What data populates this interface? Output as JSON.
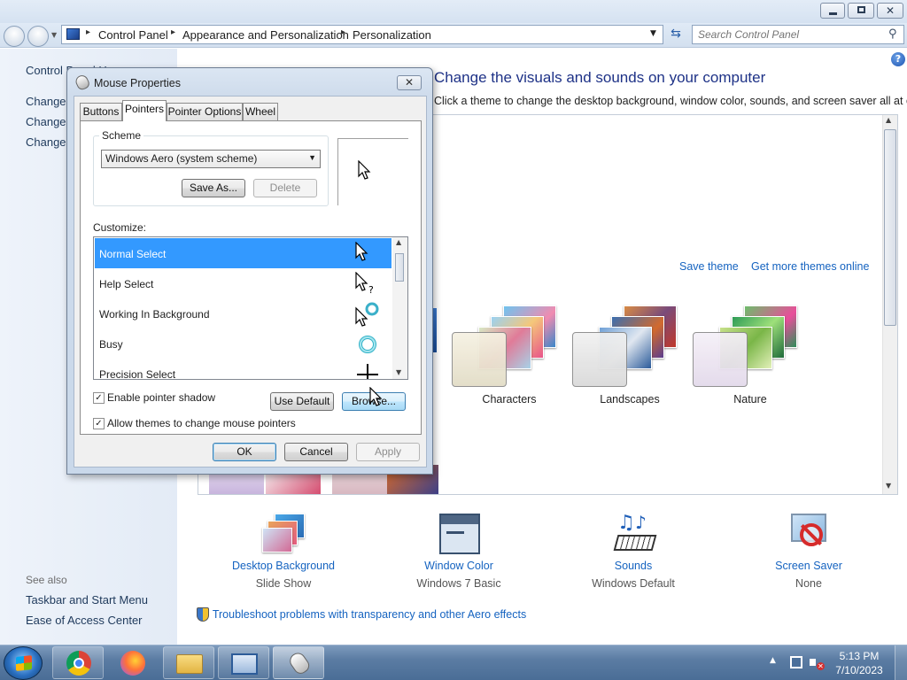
{
  "address": {
    "crumbs": [
      "Control Panel",
      "Appearance and Personalization",
      "Personalization"
    ],
    "search_placeholder": "Search Control Panel"
  },
  "leftnav": {
    "items": [
      "Control Panel Home",
      "Change desktop icons",
      "Change mouse pointers",
      "Change your account picture"
    ],
    "see_also": "See also",
    "see_also_links": [
      "Taskbar and Start Menu",
      "Ease of Access Center"
    ]
  },
  "main": {
    "heading": "Change the visuals and sounds on your computer",
    "subtext": "Click a theme to change the desktop background, window color, sounds, and screen saver all at once.",
    "save_theme": "Save theme",
    "get_more": "Get more themes online",
    "themes": [
      {
        "name": "Characters"
      },
      {
        "name": "Landscapes"
      },
      {
        "name": "Nature"
      }
    ],
    "settings": [
      {
        "label": "Desktop Background",
        "value": "Slide Show"
      },
      {
        "label": "Window Color",
        "value": "Windows 7 Basic"
      },
      {
        "label": "Sounds",
        "value": "Windows Default"
      },
      {
        "label": "Screen Saver",
        "value": "None"
      }
    ],
    "troubleshoot": "Troubleshoot problems with transparency and other Aero effects"
  },
  "dialog": {
    "title": "Mouse Properties",
    "tabs": [
      "Buttons",
      "Pointers",
      "Pointer Options",
      "Wheel"
    ],
    "active_tab": "Pointers",
    "scheme_label": "Scheme",
    "scheme_value": "Windows Aero (system scheme)",
    "save_as": "Save As...",
    "delete": "Delete",
    "customize_label": "Customize:",
    "cursors": [
      {
        "name": "Normal Select",
        "icon": "arrow-cursor-icon"
      },
      {
        "name": "Help Select",
        "icon": "help-cursor-icon"
      },
      {
        "name": "Working In Background",
        "icon": "working-cursor-icon"
      },
      {
        "name": "Busy",
        "icon": "busy-cursor-icon"
      },
      {
        "name": "Precision Select",
        "icon": "crosshair-cursor-icon"
      }
    ],
    "enable_shadow": "Enable pointer shadow",
    "allow_themes": "Allow themes to change mouse pointers",
    "use_default": "Use Default",
    "browse": "Browse...",
    "ok": "OK",
    "cancel": "Cancel",
    "apply": "Apply"
  },
  "taskbar": {
    "time": "5:13 PM",
    "date": "7/10/2023"
  },
  "colors": {
    "link": "#1563c0",
    "selection": "#3399ff",
    "heading": "#1e3287"
  }
}
